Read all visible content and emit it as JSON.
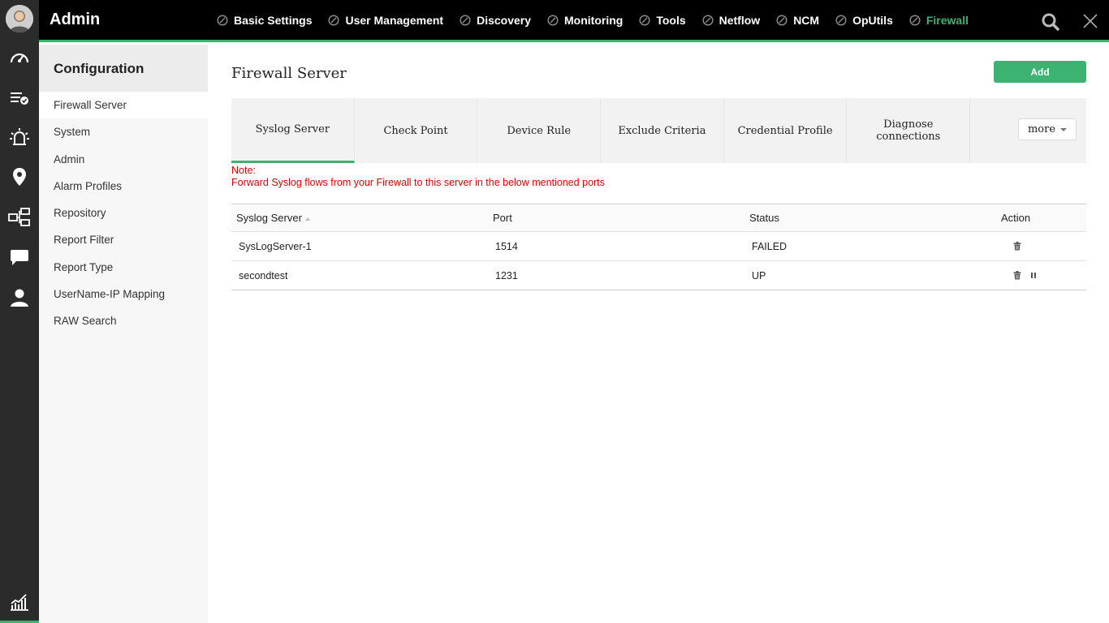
{
  "app": {
    "title": "Admin"
  },
  "topnav": {
    "items": [
      {
        "label": "Basic Settings",
        "active": false
      },
      {
        "label": "User Management",
        "active": false
      },
      {
        "label": "Discovery",
        "active": false
      },
      {
        "label": "Monitoring",
        "active": false
      },
      {
        "label": "Tools",
        "active": false
      },
      {
        "label": "Netflow",
        "active": false
      },
      {
        "label": "NCM",
        "active": false
      },
      {
        "label": "OpUtils",
        "active": false
      },
      {
        "label": "Firewall",
        "active": true
      }
    ]
  },
  "rail": {
    "icons": [
      "dashboard-icon",
      "checklist-icon",
      "alarm-icon",
      "map-pin-icon",
      "network-icon",
      "chat-icon",
      "user-icon",
      "reports-chart-icon"
    ]
  },
  "sidebar": {
    "title": "Configuration",
    "items": [
      {
        "label": "Firewall Server",
        "active": true
      },
      {
        "label": "System"
      },
      {
        "label": "Admin"
      },
      {
        "label": "Alarm Profiles"
      },
      {
        "label": "Repository"
      },
      {
        "label": "Report Filter"
      },
      {
        "label": "Report Type"
      },
      {
        "label": "UserName-IP Mapping"
      },
      {
        "label": "RAW Search"
      }
    ]
  },
  "main": {
    "title": "Firewall Server",
    "add_label": "Add",
    "tabs": [
      {
        "label": "Syslog Server",
        "active": true
      },
      {
        "label": "Check Point"
      },
      {
        "label": "Device Rule"
      },
      {
        "label": "Exclude Criteria"
      },
      {
        "label": "Credential Profile"
      },
      {
        "label": "Diagnose connections"
      }
    ],
    "more_label": "more",
    "note_title": "Note:",
    "note_text": "Forward Syslog flows from your Firewall to this server in the below mentioned ports",
    "table": {
      "headers": [
        "Syslog Server",
        "Port",
        "Status",
        "Action"
      ],
      "rows": [
        {
          "server": "SysLogServer-1",
          "port": "1514",
          "status": "FAILED",
          "actions": [
            "delete-icon"
          ]
        },
        {
          "server": "secondtest",
          "port": "1231",
          "status": "UP",
          "actions": [
            "delete-icon",
            "pause-icon"
          ]
        }
      ]
    }
  },
  "colors": {
    "accent": "#3cb371",
    "note": "#e00000",
    "topbar": "#000000",
    "rail": "#2b2b2b"
  }
}
